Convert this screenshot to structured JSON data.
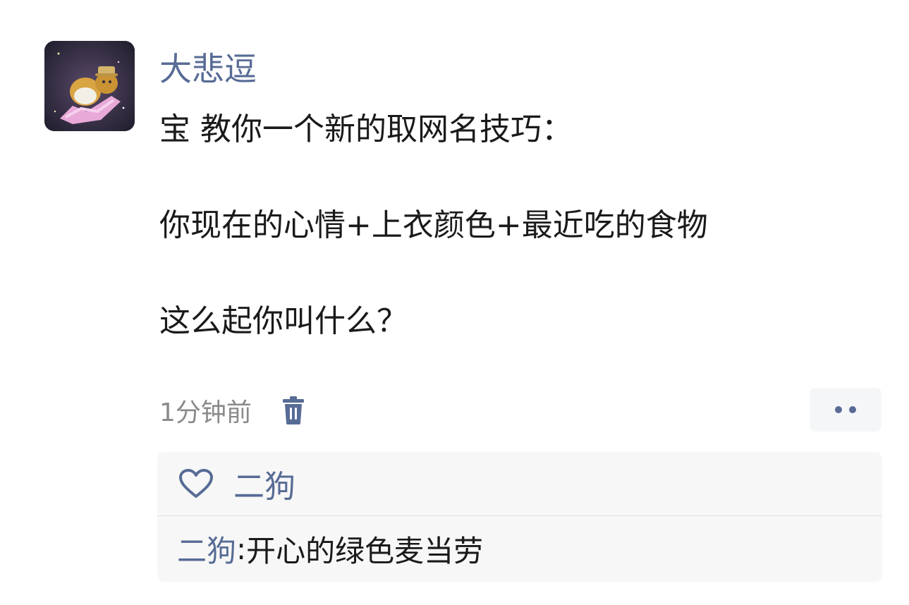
{
  "post": {
    "username": "大悲逗",
    "lines": [
      "宝 教你一个新的取网名技巧：",
      "你现在的心情+上衣颜色+最近吃的食物",
      "这么起你叫什么？"
    ],
    "timestamp": "1分钟前"
  },
  "likes": {
    "names": "二狗"
  },
  "comments": [
    {
      "author": "二狗",
      "separator": ": ",
      "text": "开心的绿色麦当劳"
    }
  ],
  "icons": {
    "trash": "trash-icon",
    "heart": "heart-icon",
    "more": "more-dots-icon"
  },
  "colors": {
    "link": "#576b95",
    "text": "#1a1a1a",
    "muted": "#8a8a8a",
    "panel": "#f7f7f7"
  }
}
